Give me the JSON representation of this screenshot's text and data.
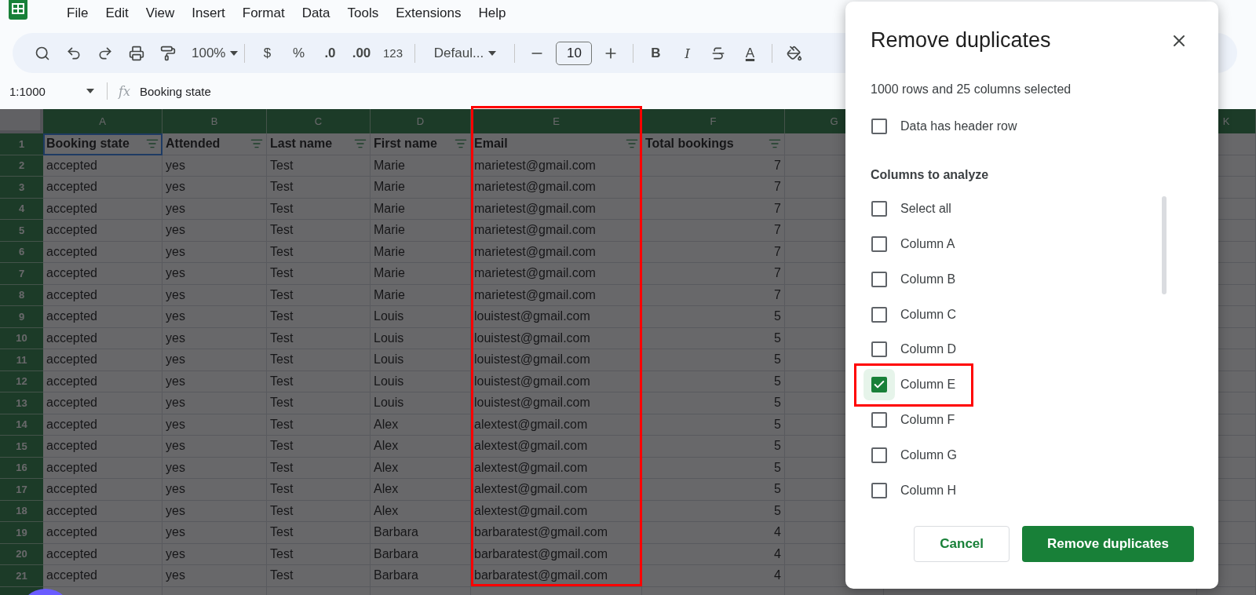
{
  "menu": [
    "File",
    "Edit",
    "View",
    "Insert",
    "Format",
    "Data",
    "Tools",
    "Extensions",
    "Help"
  ],
  "toolbar": {
    "zoom": "100%",
    "currency": "$",
    "percent": "%",
    "decrease_decimal": ".0",
    "increase_decimal": ".00",
    "number_format": "123",
    "font": "Defaul...",
    "font_size": "10",
    "bold": "B",
    "italic": "I",
    "text_color": "A"
  },
  "formula_bar": {
    "name_box": "1:1000",
    "fx": "fx",
    "formula": "Booking state"
  },
  "columns": [
    {
      "letter": "A",
      "header": "Booking state",
      "filter": true,
      "header_cell_selected": true,
      "highlighted": false
    },
    {
      "letter": "B",
      "header": "Attended",
      "filter": true,
      "header_cell_selected": false,
      "highlighted": false
    },
    {
      "letter": "C",
      "header": "Last name",
      "filter": true,
      "header_cell_selected": false,
      "highlighted": false
    },
    {
      "letter": "D",
      "header": "First name",
      "filter": true,
      "header_cell_selected": false,
      "highlighted": false
    },
    {
      "letter": "E",
      "header": "Email",
      "filter": true,
      "header_cell_selected": false,
      "highlighted": true
    },
    {
      "letter": "F",
      "header": "Total bookings",
      "filter": true,
      "header_cell_selected": false,
      "highlighted": false
    },
    {
      "letter": "G",
      "filter": false,
      "header_cell_selected": false,
      "highlighted": false
    },
    {
      "letter": "K",
      "filter": false,
      "header_cell_selected": false,
      "highlighted": false
    }
  ],
  "header_row_number": "1",
  "rows": [
    {
      "number": "2",
      "cells": [
        "accepted",
        "yes",
        "Test",
        "Marie",
        "marietest@gmail.com",
        "7"
      ]
    },
    {
      "number": "3",
      "cells": [
        "accepted",
        "yes",
        "Test",
        "Marie",
        "marietest@gmail.com",
        "7"
      ]
    },
    {
      "number": "4",
      "cells": [
        "accepted",
        "yes",
        "Test",
        "Marie",
        "marietest@gmail.com",
        "7"
      ]
    },
    {
      "number": "5",
      "cells": [
        "accepted",
        "yes",
        "Test",
        "Marie",
        "marietest@gmail.com",
        "7"
      ]
    },
    {
      "number": "6",
      "cells": [
        "accepted",
        "yes",
        "Test",
        "Marie",
        "marietest@gmail.com",
        "7"
      ]
    },
    {
      "number": "7",
      "cells": [
        "accepted",
        "yes",
        "Test",
        "Marie",
        "marietest@gmail.com",
        "7"
      ]
    },
    {
      "number": "8",
      "cells": [
        "accepted",
        "yes",
        "Test",
        "Marie",
        "marietest@gmail.com",
        "7"
      ]
    },
    {
      "number": "9",
      "cells": [
        "accepted",
        "yes",
        "Test",
        "Louis",
        "louistest@gmail.com",
        "5"
      ]
    },
    {
      "number": "10",
      "cells": [
        "accepted",
        "yes",
        "Test",
        "Louis",
        "louistest@gmail.com",
        "5"
      ]
    },
    {
      "number": "11",
      "cells": [
        "accepted",
        "yes",
        "Test",
        "Louis",
        "louistest@gmail.com",
        "5"
      ]
    },
    {
      "number": "12",
      "cells": [
        "accepted",
        "yes",
        "Test",
        "Louis",
        "louistest@gmail.com",
        "5"
      ]
    },
    {
      "number": "13",
      "cells": [
        "accepted",
        "yes",
        "Test",
        "Louis",
        "louistest@gmail.com",
        "5"
      ]
    },
    {
      "number": "14",
      "cells": [
        "accepted",
        "yes",
        "Test",
        "Alex",
        "alextest@gmail.com",
        "5"
      ]
    },
    {
      "number": "15",
      "cells": [
        "accepted",
        "yes",
        "Test",
        "Alex",
        "alextest@gmail.com",
        "5"
      ]
    },
    {
      "number": "16",
      "cells": [
        "accepted",
        "yes",
        "Test",
        "Alex",
        "alextest@gmail.com",
        "5"
      ]
    },
    {
      "number": "17",
      "cells": [
        "accepted",
        "yes",
        "Test",
        "Alex",
        "alextest@gmail.com",
        "5"
      ]
    },
    {
      "number": "18",
      "cells": [
        "accepted",
        "yes",
        "Test",
        "Alex",
        "alextest@gmail.com",
        "5"
      ]
    },
    {
      "number": "19",
      "cells": [
        "accepted",
        "yes",
        "Test",
        "Barbara",
        "barbaratest@gmail.com",
        "4"
      ]
    },
    {
      "number": "20",
      "cells": [
        "accepted",
        "yes",
        "Test",
        "Barbara",
        "barbaratest@gmail.com",
        "4"
      ]
    },
    {
      "number": "21",
      "cells": [
        "accepted",
        "yes",
        "Test",
        "Barbara",
        "barbaratest@gmail.com",
        "4"
      ]
    }
  ],
  "dialog": {
    "title": "Remove duplicates",
    "subtitle": "1000 rows and 25 columns selected",
    "header_option": {
      "label": "Data has header row",
      "checked": false
    },
    "section_title": "Columns to analyze",
    "options": [
      {
        "label": "Select all",
        "checked": false,
        "focused": false,
        "highlighted": false
      },
      {
        "label": "Column A",
        "checked": false,
        "focused": false,
        "highlighted": false
      },
      {
        "label": "Column B",
        "checked": false,
        "focused": false,
        "highlighted": false
      },
      {
        "label": "Column C",
        "checked": false,
        "focused": false,
        "highlighted": false
      },
      {
        "label": "Column D",
        "checked": false,
        "focused": false,
        "highlighted": false
      },
      {
        "label": "Column E",
        "checked": true,
        "focused": true,
        "highlighted": true
      },
      {
        "label": "Column F",
        "checked": false,
        "focused": false,
        "highlighted": false
      },
      {
        "label": "Column G",
        "checked": false,
        "focused": false,
        "highlighted": false
      },
      {
        "label": "Column H",
        "checked": false,
        "focused": false,
        "highlighted": false
      }
    ],
    "cancel": "Cancel",
    "confirm": "Remove duplicates"
  }
}
